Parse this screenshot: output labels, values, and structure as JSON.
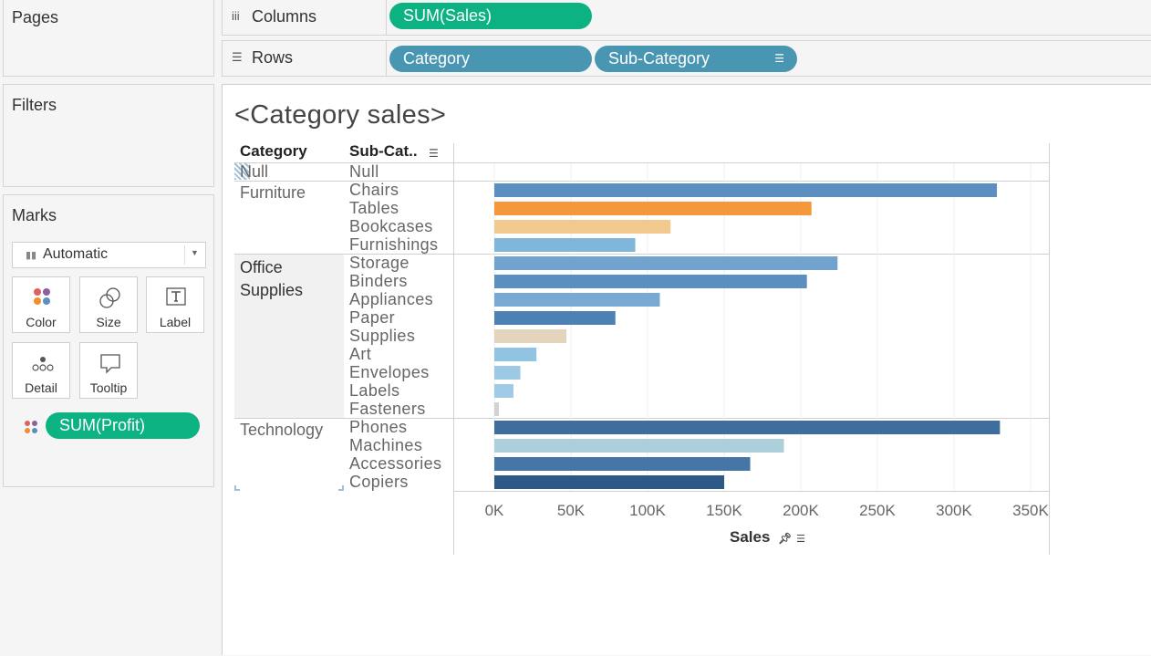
{
  "left_panels": {
    "pages_title": "Pages",
    "filters_title": "Filters",
    "marks_title": "Marks",
    "mark_type": "Automatic",
    "cards": [
      {
        "label": "Color",
        "icon": "color-icon"
      },
      {
        "label": "Size",
        "icon": "size-icon"
      },
      {
        "label": "Label",
        "icon": "label-icon"
      },
      {
        "label": "Detail",
        "icon": "detail-icon"
      },
      {
        "label": "Tooltip",
        "icon": "tooltip-icon"
      }
    ],
    "color_field": "SUM(Profit)"
  },
  "shelves": {
    "columns_label": "Columns",
    "columns_pill": "SUM(Sales)",
    "rows_label": "Rows",
    "rows_pills": [
      "Category",
      "Sub-Category"
    ]
  },
  "view": {
    "title": "<Category sales>",
    "category_header": "Category",
    "subcategory_header": "Sub-Cat..",
    "axis_title": "Sales",
    "categories": [
      {
        "name": "Null",
        "subs": [
          "Null"
        ]
      },
      {
        "name": "Furniture",
        "subs": [
          "Chairs",
          "Tables",
          "Bookcases",
          "Furnishings"
        ]
      },
      {
        "name": "Office Supplies",
        "subs": [
          "Storage",
          "Binders",
          "Appliances",
          "Paper",
          "Supplies",
          "Art",
          "Envelopes",
          "Labels",
          "Fasteners"
        ]
      },
      {
        "name": "Technology",
        "subs": [
          "Phones",
          "Machines",
          "Accessories",
          "Copiers"
        ]
      }
    ]
  },
  "chart_data": {
    "type": "bar",
    "orientation": "horizontal",
    "categories": [
      "Null",
      "Chairs",
      "Tables",
      "Bookcases",
      "Furnishings",
      "Storage",
      "Binders",
      "Appliances",
      "Paper",
      "Supplies",
      "Art",
      "Envelopes",
      "Labels",
      "Fasteners",
      "Phones",
      "Machines",
      "Accessories",
      "Copiers"
    ],
    "values": [
      0,
      328000,
      207000,
      115000,
      92000,
      224000,
      204000,
      108000,
      79000,
      47000,
      27500,
      17000,
      12500,
      3000,
      330000,
      189000,
      167000,
      150000
    ],
    "colors": [
      "#ffffff",
      "#5b8fbf",
      "#f5973b",
      "#f2c98f",
      "#7fb6d9",
      "#72a3cf",
      "#5b8fbf",
      "#78a9d3",
      "#4d80b3",
      "#e3d4bb",
      "#91c4e2",
      "#9cc9e4",
      "#a0cbe6",
      "#d3d3d3",
      "#3f6e9e",
      "#adcedb",
      "#4576a6",
      "#2d5a85"
    ],
    "xlabel": "Sales",
    "xlim": [
      0,
      360000
    ],
    "xticks": [
      "0K",
      "50K",
      "100K",
      "150K",
      "200K",
      "250K",
      "300K",
      "350K"
    ]
  }
}
